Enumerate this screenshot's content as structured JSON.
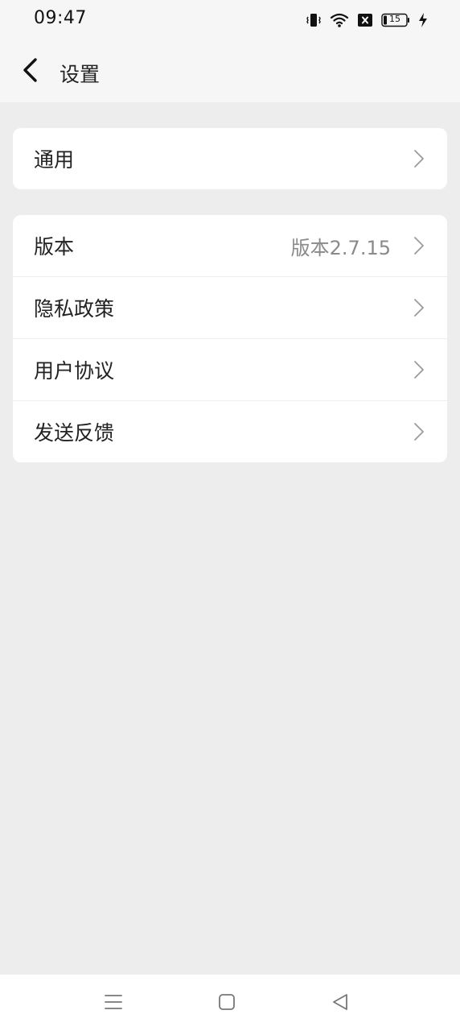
{
  "status_bar": {
    "time": "09:47",
    "battery_level": "15",
    "icons": [
      "vibrate-icon",
      "wifi-icon",
      "no-sim-icon",
      "battery-icon",
      "charging-icon"
    ]
  },
  "header": {
    "title": "设置",
    "back_icon": "chevron-left-icon"
  },
  "groups": [
    {
      "items": [
        {
          "label": "通用",
          "value": ""
        }
      ]
    },
    {
      "items": [
        {
          "label": "版本",
          "value": "版本2.7.15"
        },
        {
          "label": "隐私政策",
          "value": ""
        },
        {
          "label": "用户协议",
          "value": ""
        },
        {
          "label": "发送反馈",
          "value": ""
        }
      ]
    }
  ],
  "system_nav": {
    "icons": [
      "menu-icon",
      "home-icon",
      "back-triangle-icon"
    ]
  },
  "colors": {
    "page_background": "#ededed",
    "header_background": "#f6f6f6",
    "card_background": "#ffffff",
    "text_primary": "#222222",
    "text_secondary": "#8a8a8a",
    "chevron": "#9a9a9a"
  }
}
